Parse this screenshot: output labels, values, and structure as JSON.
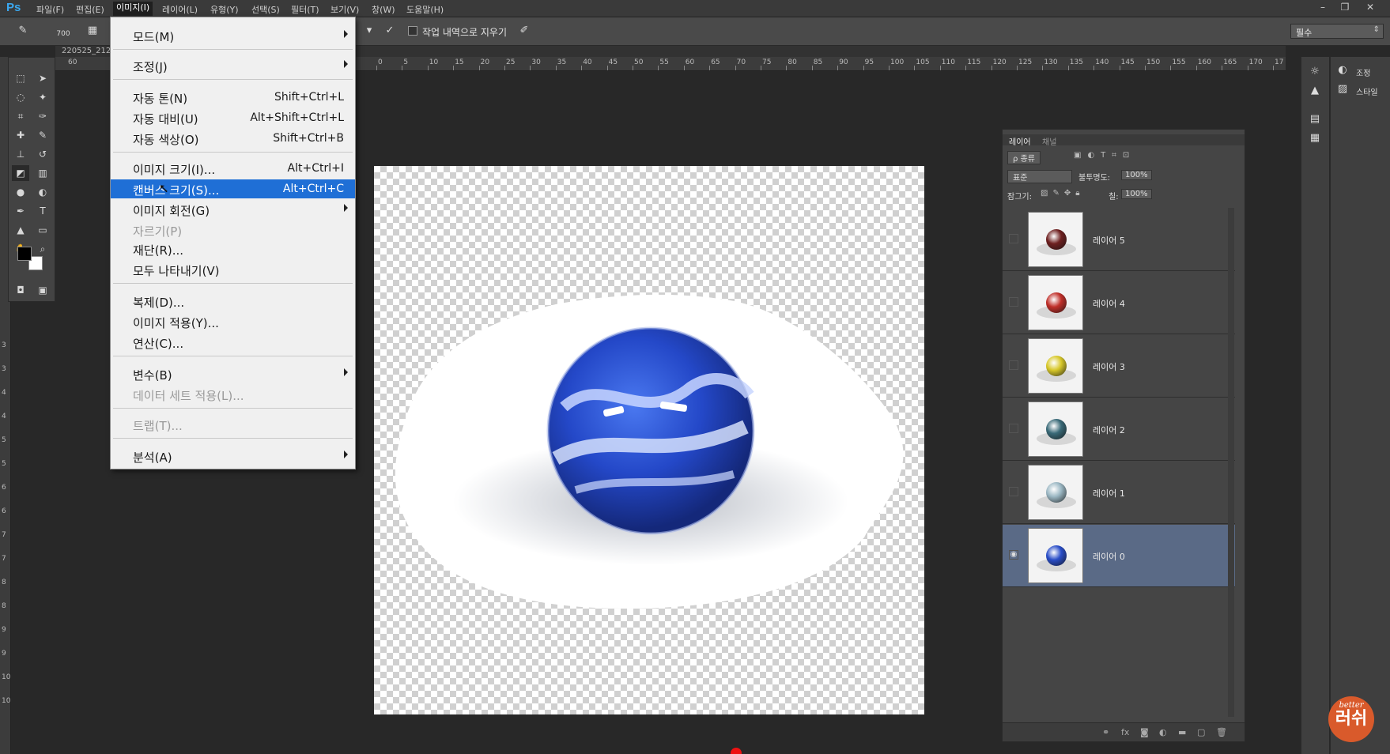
{
  "app": {
    "logo": "Ps"
  },
  "menubar": {
    "items": [
      "파일(F)",
      "편집(E)",
      "이미지(I)",
      "레이어(L)",
      "유형(Y)",
      "선택(S)",
      "필터(T)",
      "보기(V)",
      "창(W)",
      "도움말(H)"
    ],
    "active_index": 2
  },
  "window_controls": {
    "minimize": "–",
    "restore": "❐",
    "close": "✕"
  },
  "options_bar": {
    "brush_size": "700",
    "erase_to_history_label": "작업 내역으로 지우기",
    "workspace": "필수"
  },
  "document": {
    "tab_fragment": "220525_212"
  },
  "ruler_top_labels": [
    "0",
    "5",
    "10",
    "15",
    "20",
    "25",
    "30",
    "35",
    "40",
    "45",
    "50",
    "55",
    "60",
    "65",
    "70",
    "75",
    "80",
    "85",
    "90",
    "95",
    "100",
    "105",
    "110",
    "115",
    "120",
    "125",
    "130",
    "135",
    "140",
    "145",
    "150",
    "155",
    "160",
    "165",
    "170",
    "17"
  ],
  "ruler_top_offscreen_label": "60",
  "ruler_left_labels": [
    "3",
    "3",
    "4",
    "4",
    "5",
    "5",
    "6",
    "6",
    "7",
    "7",
    "8",
    "8",
    "9",
    "9",
    "10",
    "10"
  ],
  "image_menu": {
    "items": [
      {
        "label": "모드(M)",
        "submenu": true
      },
      {
        "label": "조정(J)",
        "submenu": true
      },
      {
        "label": "자동 톤(N)",
        "shortcut": "Shift+Ctrl+L"
      },
      {
        "label": "자동 대비(U)",
        "shortcut": "Alt+Shift+Ctrl+L"
      },
      {
        "label": "자동 색상(O)",
        "shortcut": "Shift+Ctrl+B"
      },
      {
        "label": "이미지 크기(I)...",
        "shortcut": "Alt+Ctrl+I"
      },
      {
        "label": "캔버스 크기(S)...",
        "shortcut": "Alt+Ctrl+C",
        "highlighted": true
      },
      {
        "label": "이미지 회전(G)",
        "submenu": true
      },
      {
        "label": "자르기(P)",
        "disabled": true
      },
      {
        "label": "재단(R)..."
      },
      {
        "label": "모두 나타내기(V)"
      },
      {
        "label": "복제(D)..."
      },
      {
        "label": "이미지 적용(Y)..."
      },
      {
        "label": "연산(C)..."
      },
      {
        "label": "변수(B)",
        "submenu": true
      },
      {
        "label": "데이터 세트 적용(L)...",
        "disabled": true
      },
      {
        "label": "트랩(T)...",
        "disabled": true
      },
      {
        "label": "분석(A)",
        "submenu": true
      }
    ]
  },
  "dock": {
    "adjust_label": "조정",
    "style_label": "스타일"
  },
  "layers_panel": {
    "tabs": [
      "레이어",
      "채널"
    ],
    "filter_label": "ρ 종류",
    "blend_mode": "표준",
    "opacity_label": "불투명도:",
    "opacity_value": "100%",
    "lock_label": "잠그기:",
    "fill_label": "칠:",
    "fill_value": "100%",
    "layers": [
      {
        "name": "레이어 5",
        "color": "#6e2020",
        "visible": false,
        "selected": false
      },
      {
        "name": "레이어 4",
        "color": "#c0302a",
        "visible": false,
        "selected": false
      },
      {
        "name": "레이어 3",
        "color": "#d8c82a",
        "visible": false,
        "selected": false
      },
      {
        "name": "레이어 2",
        "color": "#3a6a78",
        "visible": false,
        "selected": false
      },
      {
        "name": "레이어 1",
        "color": "#9cb8c4",
        "visible": false,
        "selected": false
      },
      {
        "name": "레이어 0",
        "color": "#2a4ec8",
        "visible": true,
        "selected": true
      }
    ]
  },
  "watermark": {
    "top": "better",
    "main": "러쉬"
  },
  "colors": {
    "accent": "#1f6fd6",
    "marble": "#2a4ec8",
    "fg": "#000000",
    "bg": "#ffffff"
  }
}
